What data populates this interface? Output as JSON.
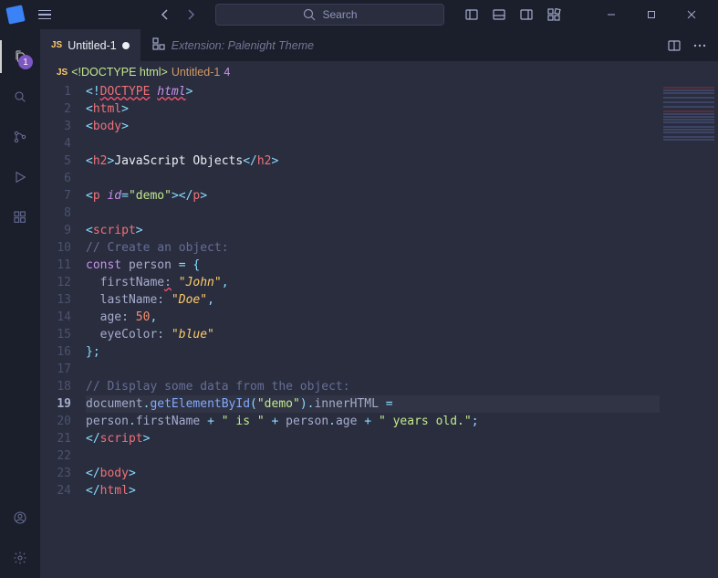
{
  "titlebar": {
    "search_placeholder": "Search"
  },
  "activitybar": {
    "explorer_badge": "1"
  },
  "tabs": [
    {
      "icon": "js",
      "label": "Untitled-1",
      "dirty": true,
      "active": true
    },
    {
      "icon": "ext",
      "label": "Extension: Palenight Theme",
      "italic": true,
      "active": false
    }
  ],
  "breadcrumb": {
    "icon": "js",
    "filename": "<!DOCTYPE html>",
    "untitled": "Untitled-1",
    "problems": "4"
  },
  "editor": {
    "current_line": 19,
    "lines": [
      {
        "n": 1,
        "h": "<span class='tk-br'>&lt;!</span><span class='tk-tag squig'>DOCTYPE</span> <span class='tk-attr squig'>html</span><span class='tk-br'>&gt;</span>"
      },
      {
        "n": 2,
        "h": "<span class='tk-br'>&lt;</span><span class='tk-tag'>html</span><span class='tk-br'>&gt;</span>"
      },
      {
        "n": 3,
        "h": "<span class='tk-br'>&lt;</span><span class='tk-tag'>body</span><span class='tk-br'>&gt;</span>"
      },
      {
        "n": 4,
        "h": ""
      },
      {
        "n": 5,
        "h": "<span class='tk-br'>&lt;</span><span class='tk-tag'>h2</span><span class='tk-br'>&gt;</span><span class='tk-txt'>JavaScript Objects</span><span class='tk-br'>&lt;/</span><span class='tk-tag'>h2</span><span class='tk-br'>&gt;</span>"
      },
      {
        "n": 6,
        "h": ""
      },
      {
        "n": 7,
        "h": "<span class='tk-br'>&lt;</span><span class='tk-tag'>p</span> <span class='tk-attr'>id</span><span class='tk-br'>=</span><span class='tk-str'>\"demo\"</span><span class='tk-br'>&gt;&lt;/</span><span class='tk-tag'>p</span><span class='tk-br'>&gt;</span>"
      },
      {
        "n": 8,
        "h": ""
      },
      {
        "n": 9,
        "h": "<span class='tk-br'>&lt;</span><span class='tk-tag'>script</span><span class='tk-br'>&gt;</span>"
      },
      {
        "n": 10,
        "h": "<span class='tk-com'>// Create an object:</span>"
      },
      {
        "n": 11,
        "h": "<span class='tk-kw'>const</span> person <span class='tk-br'>=</span> <span class='tk-br'>{</span>"
      },
      {
        "n": 12,
        "h": "  firstName<span class='squig'>:</span> <span class='tk-id'>\"John\"</span><span class='tk-br'>,</span>"
      },
      {
        "n": 13,
        "h": "  lastName: <span class='tk-id'>\"Doe\"</span><span class='tk-br'>,</span>"
      },
      {
        "n": 14,
        "h": "  age: <span class='tk-num'>50</span><span class='tk-br'>,</span>"
      },
      {
        "n": 15,
        "h": "  eyeColor: <span class='tk-id'>\"blue\"</span>"
      },
      {
        "n": 16,
        "h": "<span class='tk-br'>};</span>"
      },
      {
        "n": 17,
        "h": ""
      },
      {
        "n": 18,
        "h": "<span class='tk-com'>// Display some data from the object:</span>"
      },
      {
        "n": 19,
        "h": "document<span class='tk-br'>.</span><span class='tk-fn'>getElementById</span><span class='tk-br'>(</span><span class='tk-str'>\"demo\"</span><span class='tk-br'>).</span>innerHTML <span class='tk-br'>=</span>"
      },
      {
        "n": 20,
        "h": "person<span class='tk-br'>.</span>firstName <span class='tk-br'>+</span> <span class='tk-str'>\" is \"</span> <span class='tk-br'>+</span> person<span class='tk-br'>.</span>age <span class='tk-br'>+</span> <span class='tk-str'>\" years old.\"</span><span class='tk-br'>;</span>"
      },
      {
        "n": 21,
        "h": "<span class='tk-br'>&lt;/</span><span class='tk-tag'>script</span><span class='tk-br'>&gt;</span>"
      },
      {
        "n": 22,
        "h": ""
      },
      {
        "n": 23,
        "h": "<span class='tk-br'>&lt;/</span><span class='tk-tag'>body</span><span class='tk-br'>&gt;</span>"
      },
      {
        "n": 24,
        "h": "<span class='tk-br'>&lt;/</span><span class='tk-tag'>html</span><span class='tk-br'>&gt;</span>"
      }
    ]
  }
}
